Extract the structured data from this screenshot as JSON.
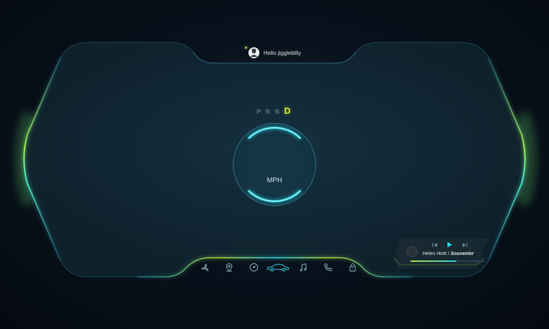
{
  "greeting": {
    "text": "Hello jigglebilly",
    "online": true
  },
  "gear": {
    "options": [
      "P",
      "R",
      "N",
      "D"
    ],
    "selected": "D"
  },
  "speedometer": {
    "unit": "MPH"
  },
  "nav": {
    "items": [
      {
        "name": "climate",
        "icon": "fan-icon"
      },
      {
        "name": "navigation",
        "icon": "map-pin-icon"
      },
      {
        "name": "dashboard",
        "icon": "gauge-icon"
      },
      {
        "name": "vehicle",
        "icon": "car-icon",
        "active": true
      },
      {
        "name": "music",
        "icon": "music-note-icon"
      },
      {
        "name": "phone",
        "icon": "phone-icon"
      },
      {
        "name": "lock",
        "icon": "lock-icon"
      }
    ]
  },
  "media": {
    "artist": "Helen Hiott",
    "separator": " / ",
    "song": "Souvenier",
    "progress": 0.62,
    "state": "paused"
  },
  "colors": {
    "accent": "#2fd3e0",
    "accent_green": "#b3e43a",
    "gear_active": "#d8ef3a",
    "background": "#07101a"
  }
}
